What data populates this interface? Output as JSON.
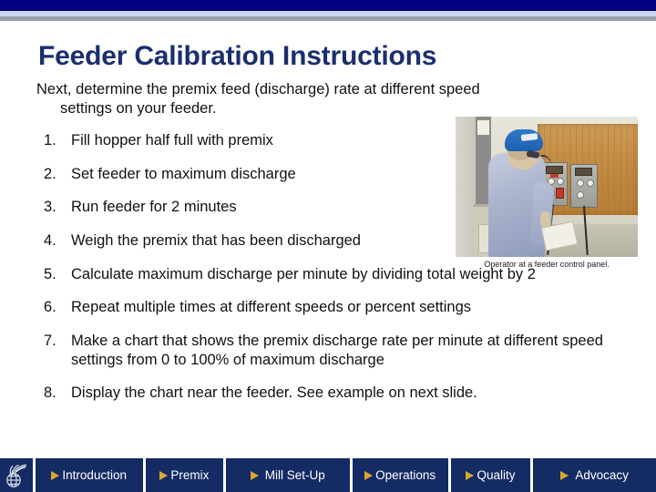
{
  "slide": {
    "title": "Feeder Calibration Instructions",
    "intro_line1": "Next, determine the premix feed (discharge) rate at different speed",
    "intro_line2": "settings on your feeder.",
    "steps": [
      {
        "num": "1.",
        "text": "Fill hopper half full with premix"
      },
      {
        "num": "2.",
        "text": "Set feeder to maximum discharge"
      },
      {
        "num": "3.",
        "text": "Run feeder for 2 minutes"
      },
      {
        "num": "4.",
        "text": "Weigh the premix that has been discharged"
      },
      {
        "num": "5.",
        "text": "Calculate maximum discharge per minute by dividing total weight by 2"
      },
      {
        "num": "6.",
        "text": "Repeat multiple times at different speeds or percent settings"
      },
      {
        "num": "7.",
        "text": "Make a chart that shows the premix discharge rate per minute at different speed settings from 0 to 100% of maximum discharge"
      },
      {
        "num": "8.",
        "text": "Display the chart near the feeder. See example on next slide."
      }
    ]
  },
  "photo": {
    "alt": "operator-at-feeder-control-panel-photo",
    "caption": "Operator at a feeder control panel."
  },
  "navbar": {
    "logo_name": "globe-wheat-logo",
    "arrow_icon": "triangle-right-icon",
    "tabs": [
      {
        "label": "Introduction"
      },
      {
        "label": "Premix"
      },
      {
        "label": "Mill Set-Up"
      },
      {
        "label": "Operations"
      },
      {
        "label": "Quality"
      },
      {
        "label": "Advocacy"
      }
    ]
  },
  "colors": {
    "topbar_navy": "#010080",
    "topbar_light": "#ccd6f0",
    "topbar_gray": "#9aa0ae",
    "title_blue": "#1b2f6e",
    "nav_bg": "#142b63",
    "nav_arrow_gold": "#d9a82e",
    "body_text": "#111111"
  }
}
